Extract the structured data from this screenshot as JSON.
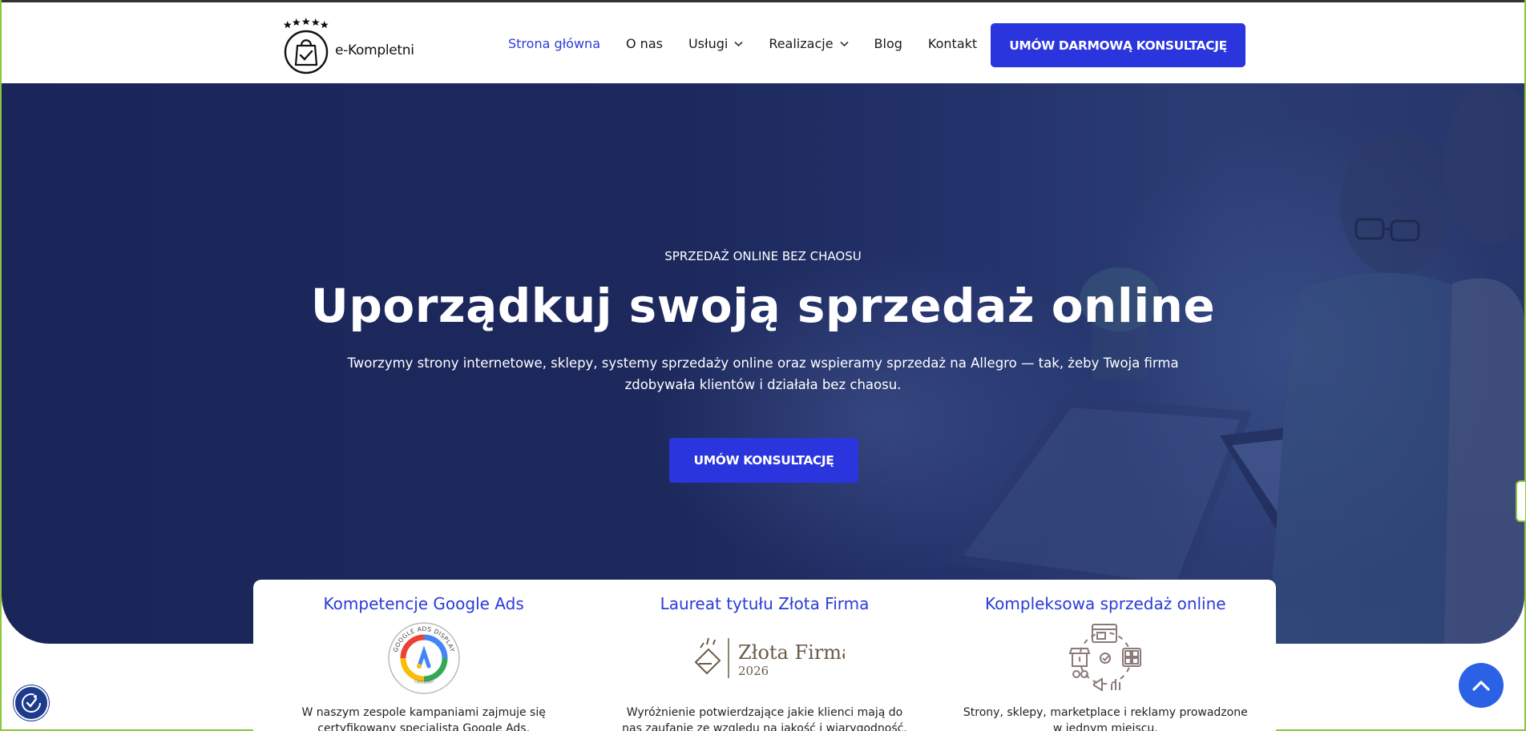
{
  "header": {
    "logo_text": "e-Kompletni",
    "nav": [
      {
        "label": "Strona główna",
        "active": true,
        "has_dropdown": false
      },
      {
        "label": "O nas",
        "active": false,
        "has_dropdown": false
      },
      {
        "label": "Usługi",
        "active": false,
        "has_dropdown": true
      },
      {
        "label": "Realizacje",
        "active": false,
        "has_dropdown": true
      },
      {
        "label": "Blog",
        "active": false,
        "has_dropdown": false
      },
      {
        "label": "Kontakt",
        "active": false,
        "has_dropdown": false
      }
    ],
    "cta_label": "UMÓW DARMOWĄ KONSULTACJĘ"
  },
  "hero": {
    "eyebrow": "SPRZEDAŻ ONLINE BEZ CHAOSU",
    "headline": "Uporządkuj swoją sprzedaż online",
    "subtext": "Tworzymy strony internetowe, sklepy, systemy sprzedaży online oraz wspieramy sprzedaż na Allegro — tak, żeby Twoja firma zdobywała klientów i działała bez chaosu.",
    "cta_label": "UMÓW KONSULTACJĘ"
  },
  "cards": [
    {
      "title": "Kompetencje Google Ads",
      "icon": "google-ads-badge-icon",
      "badge_text": "GOOGLE ADS DISPLAY",
      "badge_subtext": "CERTIFIED",
      "desc": "W naszym zespole kampaniami zajmuje się certyfikowany specjalista Google Ads."
    },
    {
      "title": "Laureat tytułu Złota Firma",
      "icon": "zlota-firma-logo-icon",
      "badge_text": "Złota Firma",
      "badge_subtext": "2026",
      "desc": "Wyróżnienie potwierdzające jakie klienci mają do nas zaufanie ze względu na jakość i wiarygodność."
    },
    {
      "title": "Kompleksowa sprzedaż online",
      "icon": "online-sales-icon",
      "desc": "Strony, sklepy, marketplace i reklamy prowadzone w jednym miejscu."
    }
  ],
  "colors": {
    "accent": "#2b35dd",
    "nav_active": "#2a3bd9",
    "hero_bg": "#1d295d",
    "scroll_top": "#2b62e5"
  }
}
